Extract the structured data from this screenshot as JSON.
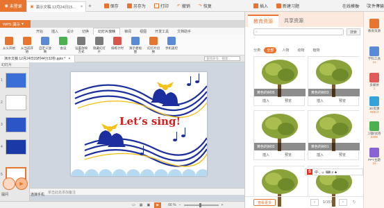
{
  "titlebar": {
    "login": "未登录",
    "doc_tab": "演示文稿 12月24日15...",
    "save": "保存",
    "save_as": "另存为",
    "print": "打印",
    "undo": "撤销",
    "redo": "恢复",
    "insert": "插入",
    "new_slide": "新建习题",
    "files_label": "在线模板",
    "file_ops": "文件传输"
  },
  "wps_menu": "WPS 演示",
  "ribbon_tabs": [
    "开始",
    "插入",
    "设计",
    "切换",
    "幻灯片放映",
    "审阅",
    "视图",
    "开发工具",
    "文档助手"
  ],
  "ribbon_active": "幻灯片放映",
  "ribbon_buttons": [
    "从头开始",
    "从当前开始",
    "自定义放映",
    "会议",
    "设置放映方式",
    "隐藏幻灯片",
    "排练计时",
    "演示者视图",
    "幻灯片切换",
    "手机遥控"
  ],
  "docstrip": {
    "tab": "演示文稿 12月24日15时44分32秒.pptx *",
    "search_placeholder": "查找命令、搜索..."
  },
  "slide_panel": {
    "header": "幻灯片",
    "numbers": [
      "1",
      "2",
      "3",
      "4",
      "5"
    ]
  },
  "slide": {
    "text": "Let’s sing!"
  },
  "notes_placeholder": "单击此处添加备注",
  "statusbar": {
    "zoom": "66 %"
  },
  "bubbles": [
    "提问",
    "连接手机"
  ],
  "resources": {
    "tab_edu": "教育资源",
    "tab_share": "共享资源",
    "search_button": "搜索",
    "category_label": "分类:",
    "categories": [
      "全部",
      "人物",
      "动物",
      "植物"
    ],
    "active_category": "全部",
    "cards": [
      {
        "caption": "黄色的树05",
        "insert": "插入",
        "preview": "预览"
      },
      {
        "caption": "黄色的树03",
        "insert": "插入",
        "preview": "预览"
      },
      {
        "caption": "黄色的树02",
        "insert": "插入",
        "preview": "预览"
      },
      {
        "caption": "黄色的树01",
        "insert": "插入",
        "preview": "预览"
      },
      {
        "caption": "",
        "insert": "",
        "preview": ""
      },
      {
        "caption": "",
        "insert": "",
        "preview": ""
      }
    ],
    "more_button": "查看更多",
    "page": "1/1579",
    "ime_glyphs": "中·, ☺ ⌨ ≡ ♣"
  },
  "sidebar": [
    {
      "label": "教育资源",
      "count": ""
    },
    {
      "label": "学科工具",
      "count": "11"
    },
    {
      "label": "多媒体",
      "count": "1"
    },
    {
      "label": "3D资源",
      "count": "31514"
    },
    {
      "label": "习题/试卷",
      "count": "8466"
    },
    {
      "label": "PPT主题",
      "count": "24"
    }
  ],
  "colors": {
    "accent": "#e8752f",
    "slide_blue": "#1c2f9c",
    "bell_gold": "#f4c21b",
    "title_red": "#d81d1d"
  }
}
